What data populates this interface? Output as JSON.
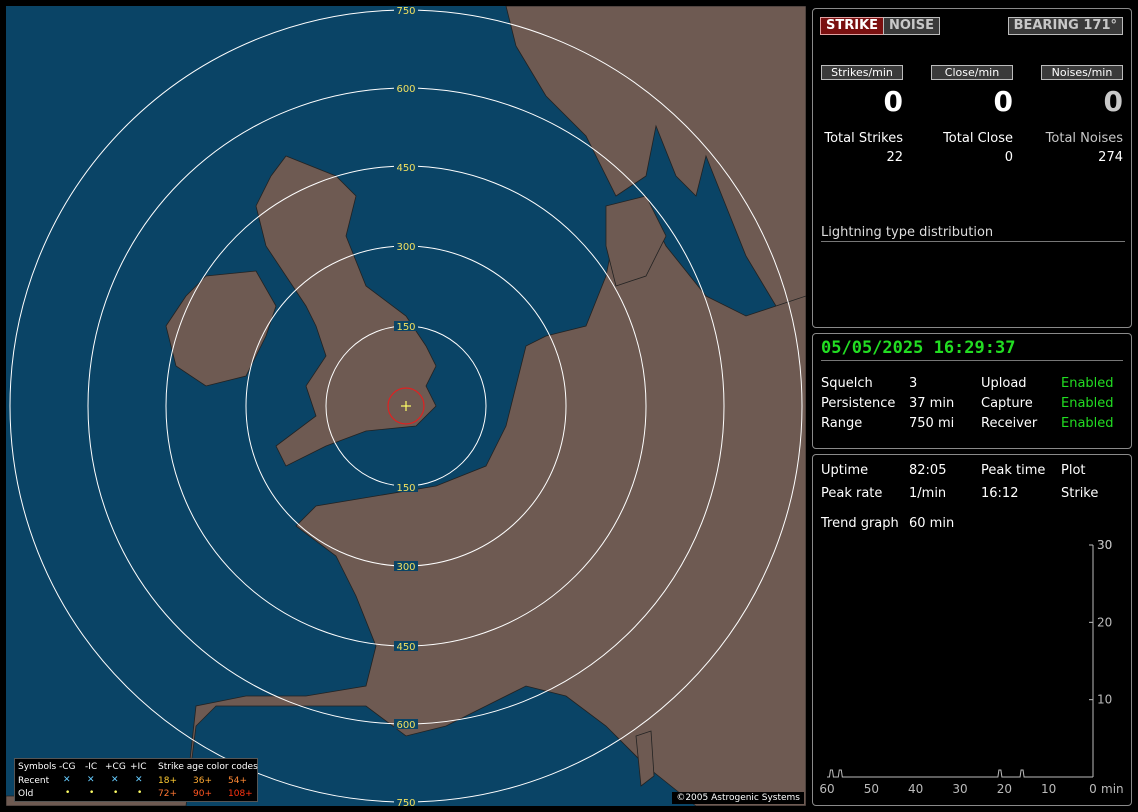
{
  "map": {
    "ring_labels": [
      "150",
      "300",
      "450",
      "600",
      "750"
    ],
    "legend": {
      "symbols_label": "Symbols",
      "recent_label": "Recent",
      "old_label": "Old",
      "types": [
        "-CG",
        "-IC",
        "+CG",
        "+IC"
      ],
      "age_label": "Strike age color codes",
      "recent_ages": [
        "18+",
        "36+",
        "54+"
      ],
      "old_ages": [
        "72+",
        "90+",
        "108+"
      ]
    },
    "copyright": "©2005 Astrogenic Systems",
    "colors": {
      "sea": "#0a4466",
      "land": "#6e5a52",
      "rings": "#ffffff",
      "ring_labels": "#f0e060",
      "center_cursor": "#ffff66",
      "close_circle": "#dd2222"
    }
  },
  "status": {
    "strike_label": "STRIKE",
    "noise_label": "NOISE",
    "bearing_label": "BEARING 171°"
  },
  "rates": {
    "strikes_label": "Strikes/min",
    "close_label": "Close/min",
    "noises_label": "Noises/min",
    "strikes_value": "0",
    "close_value": "0",
    "noises_value": "0"
  },
  "totals": {
    "strikes_label": "Total Strikes",
    "close_label": "Total Close",
    "noises_label": "Total Noises",
    "strikes_value": "22",
    "close_value": "0",
    "noises_value": "274"
  },
  "distribution": {
    "title": "Lightning type distribution"
  },
  "settings": {
    "datetime": "05/05/2025 16:29:37",
    "squelch_label": "Squelch",
    "squelch_value": "3",
    "persistence_label": "Persistence",
    "persistence_value": "37 min",
    "range_label": "Range",
    "range_value": "750 mi",
    "upload_label": "Upload",
    "upload_value": "Enabled",
    "capture_label": "Capture",
    "capture_value": "Enabled",
    "receiver_label": "Receiver",
    "receiver_value": "Enabled"
  },
  "stats": {
    "uptime_label": "Uptime",
    "uptime_value": "82:05",
    "peak_time_label": "Peak time",
    "peak_time_value": "16:12",
    "plot_label": "Plot",
    "plot_value": "Strike",
    "peak_rate_label": "Peak rate",
    "peak_rate_value": "1/min",
    "trend_label": "Trend graph",
    "trend_value": "60 min"
  },
  "trend_graph": {
    "x_ticks": [
      "60",
      "50",
      "40",
      "30",
      "20",
      "10",
      "0"
    ],
    "x_unit": "min",
    "y_ticks": [
      "10",
      "20",
      "30"
    ],
    "y_max": 30,
    "bumps_at_minutes_ago": [
      59,
      57,
      21,
      16
    ]
  }
}
